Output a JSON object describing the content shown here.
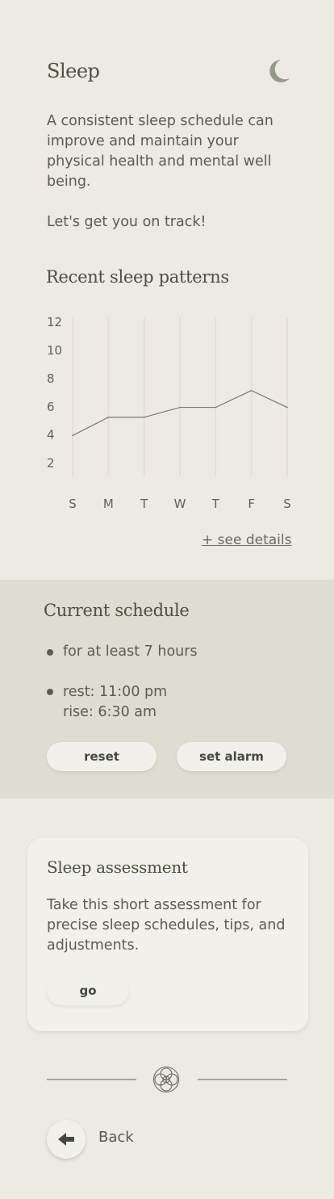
{
  "header": {
    "title": "Sleep",
    "icon": "moon-icon"
  },
  "intro": {
    "text": "A consistent sleep schedule can improve and maintain your physical health and mental well being.",
    "cta": "Let's get you on track!"
  },
  "recent": {
    "title": "Recent sleep patterns",
    "see_details": "+ see details"
  },
  "chart_data": {
    "type": "line",
    "categories": [
      "S",
      "M",
      "T",
      "W",
      "T",
      "F",
      "S"
    ],
    "values": [
      3.9,
      5.2,
      5.2,
      5.9,
      5.9,
      7.1,
      5.9
    ],
    "y_ticks": [
      2,
      4,
      6,
      8,
      10,
      12
    ],
    "ylim": [
      1,
      12.3
    ],
    "grid": "vertical",
    "line_color": "#7a7c74",
    "grid_color": "#e2ded6"
  },
  "schedule": {
    "title": "Current schedule",
    "duration": "for at least 7 hours",
    "rest": "rest: 11:00 pm",
    "rise": "rise: 6:30 am",
    "reset_label": "reset",
    "alarm_label": "set alarm"
  },
  "assessment": {
    "title": "Sleep assessment",
    "text": "Take this short assessment for precise sleep schedules, tips, and adjustments.",
    "go_label": "go"
  },
  "footer": {
    "divider_icon": "flower-icon",
    "back_label": "Back"
  },
  "colors": {
    "background": "#ede9e3",
    "schedule_band": "#dfdcd1",
    "card": "#f2f0ea",
    "accent": "#4b5141"
  }
}
